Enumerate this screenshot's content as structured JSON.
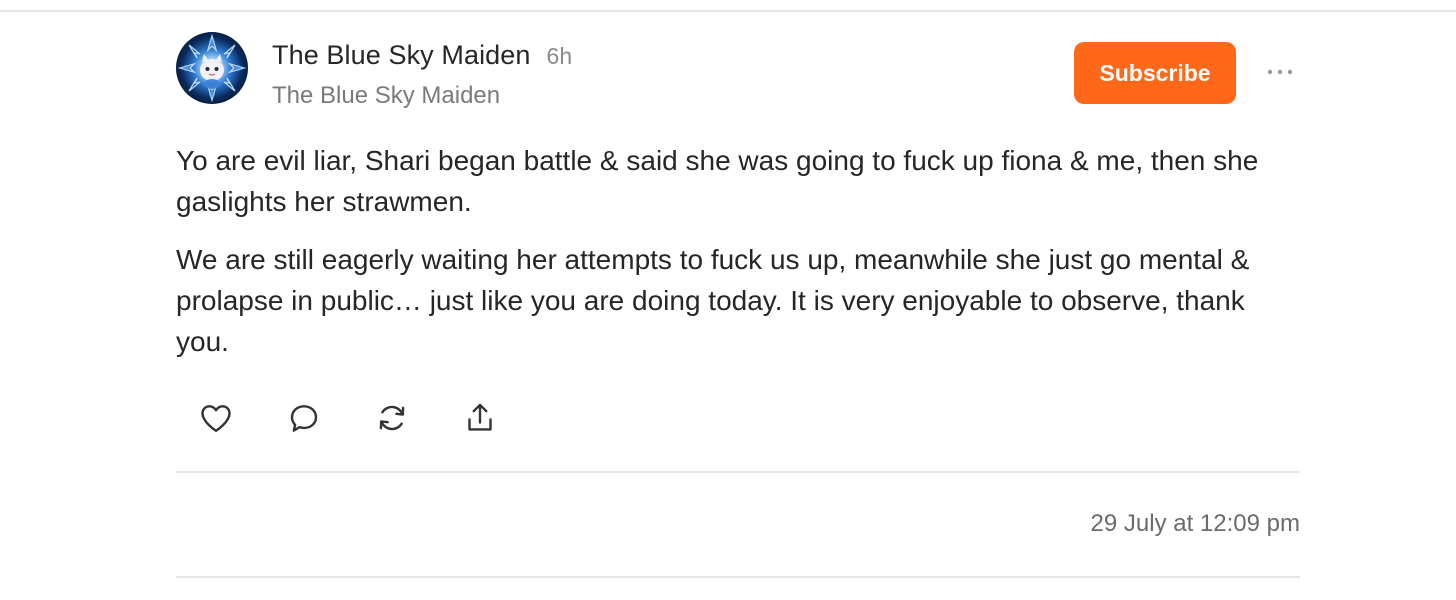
{
  "note": {
    "author_name": "The Blue Sky Maiden",
    "relative_time": "6h",
    "publication_name": "The Blue Sky Maiden",
    "subscribe_label": "Subscribe",
    "paragraphs": [
      "Yo are evil liar, Shari began battle & said she was going to fuck up fiona & me, then she gaslights her strawmen.",
      "We are still eagerly waiting her attempts to fuck us up, meanwhile she just go mental & prolapse in public… just like you are doing today. It is very enjoyable to observe, thank you."
    ],
    "actions": [
      {
        "icon": "heart-icon"
      },
      {
        "icon": "comment-icon"
      },
      {
        "icon": "restack-icon"
      },
      {
        "icon": "share-icon"
      }
    ],
    "timestamp": "29 July at 12:09 pm"
  },
  "colors": {
    "accent": "#ff6719",
    "text": "#262626",
    "muted": "#7a7a7a",
    "divider": "#e6e6e6"
  }
}
